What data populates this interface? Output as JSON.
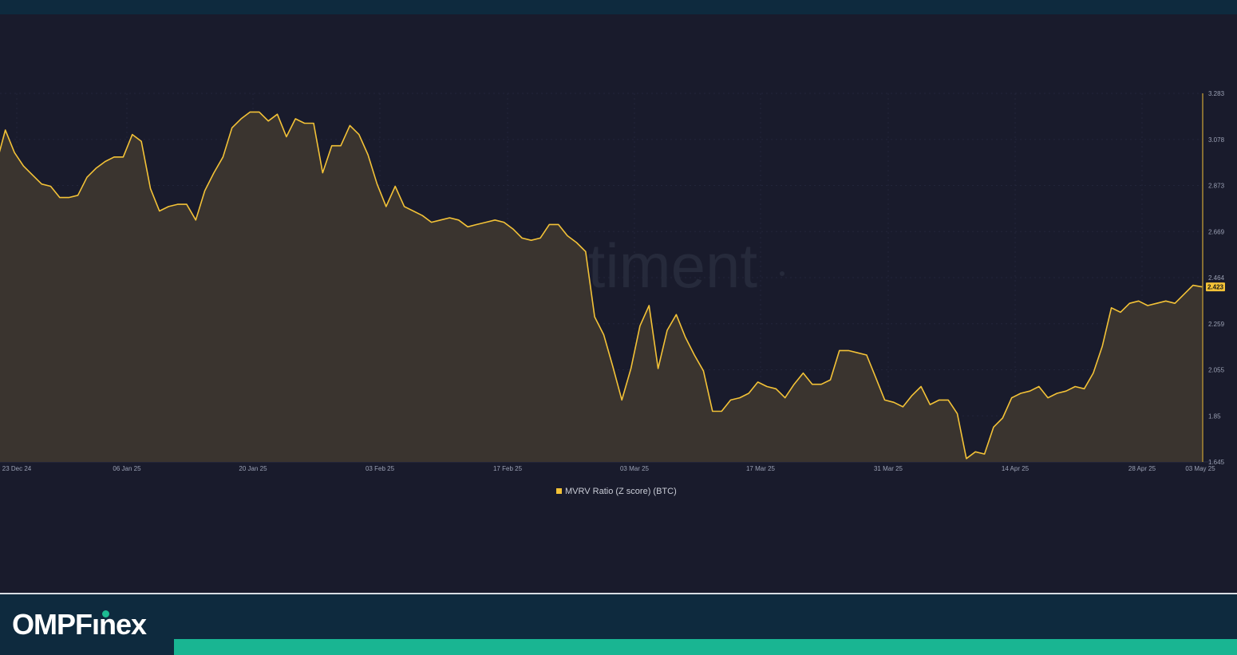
{
  "brand": {
    "name_part1": "OMPF",
    "name_part2": "nex",
    "accent_color": "#19b592"
  },
  "colors": {
    "line": "#f3c237",
    "area": "#3a342f",
    "background": "#191b2c",
    "footer": "#0e2a3e"
  },
  "watermark": "santiment",
  "chart_data": {
    "type": "area",
    "title": "",
    "xlabel": "",
    "ylabel": "",
    "legend": {
      "position": "bottom-center",
      "entries": [
        "MVRV Ratio (Z score) (BTC)"
      ]
    },
    "grid": true,
    "x_tick_labels": [
      "23 Dec 24",
      "06 Jan 25",
      "20 Jan 25",
      "03 Feb 25",
      "17 Feb 25",
      "03 Mar 25",
      "17 Mar 25",
      "31 Mar 25",
      "14 Apr 25",
      "28 Apr 25",
      "03 May 25"
    ],
    "y_tick_labels": [
      "3.283",
      "3.078",
      "2.873",
      "2.669",
      "2.464",
      "2.259",
      "2.055",
      "1.85",
      "1.645"
    ],
    "ylim": [
      1.645,
      3.283
    ],
    "current_value": "2.423",
    "series": [
      {
        "name": "MVRV Ratio (Z score) (BTC)",
        "x_start": "2024-12-21",
        "interval": "1d",
        "values": [
          2.92,
          2.97,
          3.12,
          3.02,
          2.96,
          2.92,
          2.88,
          2.87,
          2.82,
          2.82,
          2.83,
          2.91,
          2.95,
          2.98,
          3.0,
          3.0,
          3.1,
          3.07,
          2.86,
          2.76,
          2.78,
          2.79,
          2.79,
          2.72,
          2.85,
          2.93,
          3.0,
          3.13,
          3.17,
          3.2,
          3.2,
          3.16,
          3.19,
          3.09,
          3.17,
          3.15,
          3.15,
          2.93,
          3.05,
          3.05,
          3.14,
          3.1,
          3.01,
          2.88,
          2.78,
          2.87,
          2.78,
          2.76,
          2.74,
          2.71,
          2.72,
          2.73,
          2.72,
          2.69,
          2.7,
          2.71,
          2.72,
          2.71,
          2.68,
          2.64,
          2.63,
          2.64,
          2.7,
          2.7,
          2.65,
          2.62,
          2.58,
          2.29,
          2.21,
          2.07,
          1.92,
          2.06,
          2.25,
          2.34,
          2.06,
          2.23,
          2.3,
          2.2,
          2.12,
          2.05,
          1.87,
          1.87,
          1.92,
          1.93,
          1.95,
          2.0,
          1.98,
          1.97,
          1.93,
          1.99,
          2.04,
          1.99,
          1.99,
          2.01,
          2.14,
          2.14,
          2.13,
          2.12,
          2.02,
          1.92,
          1.91,
          1.89,
          1.94,
          1.98,
          1.9,
          1.92,
          1.92,
          1.86,
          1.66,
          1.69,
          1.68,
          1.8,
          1.84,
          1.93,
          1.95,
          1.96,
          1.98,
          1.93,
          1.95,
          1.96,
          1.98,
          1.97,
          2.04,
          2.16,
          2.33,
          2.31,
          2.35,
          2.36,
          2.34,
          2.35,
          2.36,
          2.35,
          2.39,
          2.43,
          2.423
        ]
      }
    ]
  }
}
